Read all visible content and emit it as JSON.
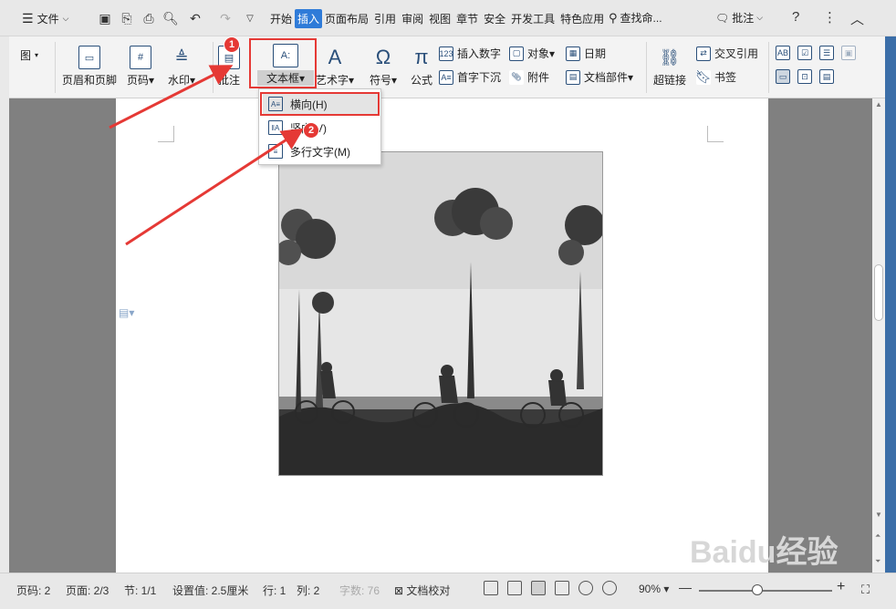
{
  "menubar": {
    "file_label": "文件",
    "tabs": [
      "开始",
      "插入",
      "页面布局",
      "引用",
      "审阅",
      "视图",
      "章节",
      "安全",
      "开发工具",
      "特色应用"
    ],
    "active_tab": "插入",
    "search_label": "查找命...",
    "comment_label": "批注"
  },
  "ribbon": {
    "partial_label": "图",
    "header_footer": "页眉和页脚",
    "page_number": "页码",
    "watermark": "水印",
    "comment": "批注",
    "textbox": "文本框",
    "wordart": "艺术字",
    "symbol": "符号",
    "formula": "公式",
    "insert_number": "插入数字",
    "object": "对象",
    "date": "日期",
    "drop_cap": "首字下沉",
    "attachment": "附件",
    "doc_parts": "文档部件",
    "hyperlink": "超链接",
    "cross_ref": "交叉引用",
    "bookmark": "书签"
  },
  "dropdown": {
    "items": [
      "横向(H)",
      "竖向(V)",
      "多行文字(M)"
    ]
  },
  "badges": [
    "1",
    "2"
  ],
  "status": {
    "page_num": "页码: 2",
    "pages": "页面: 2/3",
    "section": "节: 1/1",
    "setting": "设置值: 2.5厘米",
    "row": "行: 1",
    "col": "列: 2",
    "words": "字数: 76",
    "proof": "文档校对",
    "zoom": "90%"
  },
  "watermark_text": "Baidu经验",
  "colors": {
    "accent": "#2f7bd8",
    "highlight": "#e53935"
  }
}
